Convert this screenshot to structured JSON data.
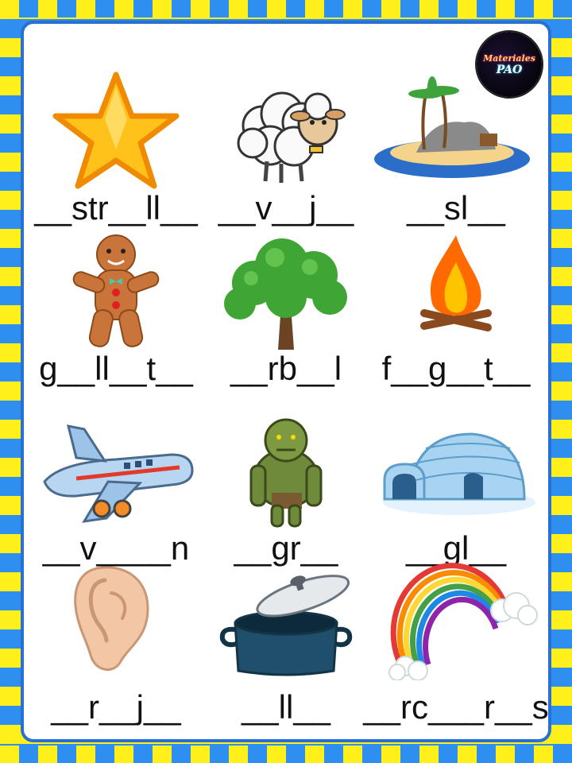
{
  "logo": {
    "line1": "Materiales",
    "line2": "PAO"
  },
  "words": [
    "__str__ll__",
    "__v__j__",
    "__sl__",
    "g__ll__t__",
    "__rb__l",
    "f__g__t__",
    "__v____n",
    "__gr__",
    "__gl__",
    "__r__j__",
    "__ll__",
    "__rc___r__s"
  ],
  "icons": [
    "star-icon",
    "sheep-icon",
    "island-icon",
    "gingerbread-icon",
    "tree-icon",
    "campfire-icon",
    "airplane-icon",
    "ogre-icon",
    "igloo-icon",
    "ear-icon",
    "pot-icon",
    "rainbow-icon"
  ],
  "colors": {
    "stripe_yellow": "#ffef1a",
    "stripe_blue": "#2f8ff0",
    "sheet_border": "#2a6fd6"
  }
}
